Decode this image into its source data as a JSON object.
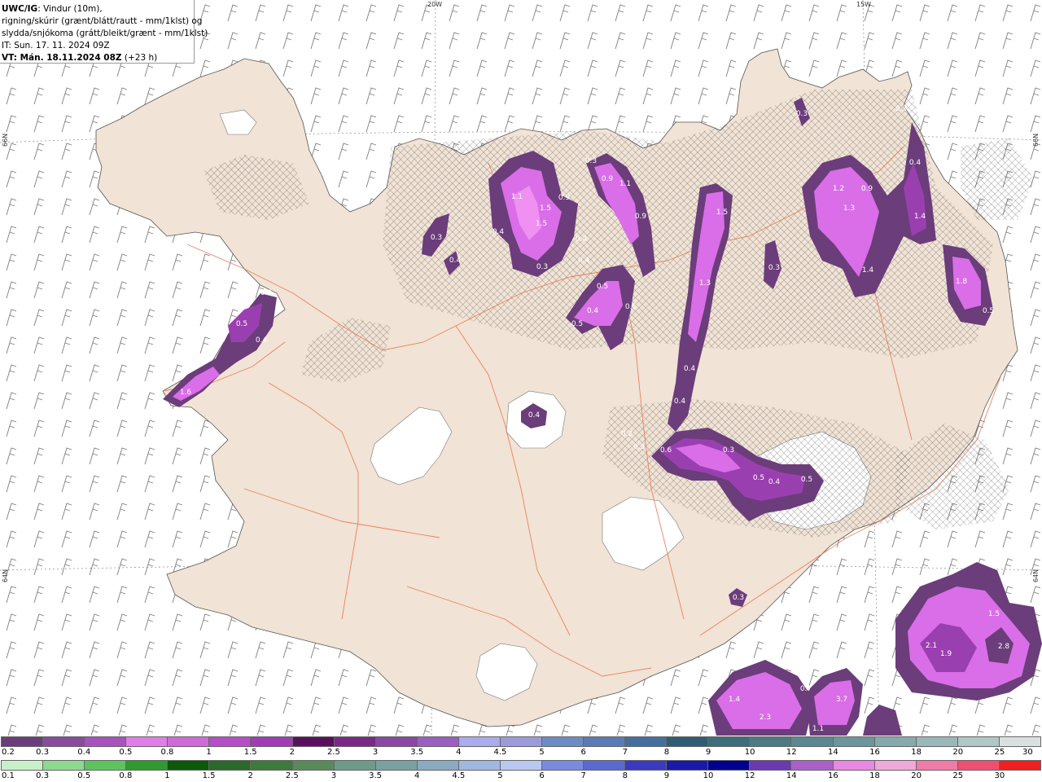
{
  "header": {
    "model": "UWC/IG",
    "desc1": ": Vindur (10m),",
    "desc2": "rigning/skúrir (grænt/blátt/rautt - mm/1klst) og",
    "desc3": "slydda/snjókoma (grátt/bleikt/grænt - mm/1klst)",
    "init": "IT: Sun. 17. 11. 2024 09Z",
    "valid_bold": "VT: Mán. 18.11.2024 08Z",
    "valid_rest": " (+23 h)"
  },
  "coords": {
    "top_20w": "20W",
    "top_15w": "15W",
    "left_66n": "66N",
    "right_66n": "66N",
    "left_64n": "64N",
    "right_64n": "64N"
  },
  "colors": {
    "land": "#f1e3d5",
    "ice": "#ffffff",
    "road": "#e8724a",
    "sleet_dark": "#6b3d7a",
    "sleet_mid": "#9a3fb0",
    "sleet_light": "#d96ee8",
    "sleet_pale": "#f090f0"
  },
  "values": [
    {
      "t": "0.4"
    },
    {
      "t": "0.5"
    },
    {
      "t": "0.4"
    },
    {
      "t": "1.6"
    },
    {
      "t": "0.3"
    },
    {
      "t": "0.4"
    },
    {
      "t": "1.1"
    },
    {
      "t": "1.5"
    },
    {
      "t": "1.5"
    },
    {
      "t": "0.4"
    },
    {
      "t": "0.3"
    },
    {
      "t": "0.9"
    },
    {
      "t": "0.3"
    },
    {
      "t": "0.9"
    },
    {
      "t": "1.1"
    },
    {
      "t": "0.4"
    },
    {
      "t": "0.4"
    },
    {
      "t": "0.9"
    },
    {
      "t": "0.5"
    },
    {
      "t": "0.4"
    },
    {
      "t": "0.6"
    },
    {
      "t": "0.5"
    },
    {
      "t": "1.5"
    },
    {
      "t": "1.3"
    },
    {
      "t": "0.4"
    },
    {
      "t": "0.4"
    },
    {
      "t": "0.3"
    },
    {
      "t": "0.3"
    },
    {
      "t": "1.2"
    },
    {
      "t": "0.9"
    },
    {
      "t": "1.3"
    },
    {
      "t": "1.4"
    },
    {
      "t": "0.4"
    },
    {
      "t": "1.4"
    },
    {
      "t": "1.8"
    },
    {
      "t": "0.5"
    },
    {
      "t": "0.3"
    },
    {
      "t": "0.4"
    },
    {
      "t": "0.2"
    },
    {
      "t": "0.3"
    },
    {
      "t": "0.6"
    },
    {
      "t": "0.3"
    },
    {
      "t": "0.5"
    },
    {
      "t": "0.4"
    },
    {
      "t": "0.5"
    },
    {
      "t": "0.3"
    },
    {
      "t": "1.5"
    },
    {
      "t": "2.1"
    },
    {
      "t": "1.9"
    },
    {
      "t": "2.8"
    },
    {
      "t": "1.4"
    },
    {
      "t": "2.3"
    },
    {
      "t": "0.7"
    },
    {
      "t": "3.7"
    },
    {
      "t": "1.1"
    }
  ],
  "legend": {
    "snow_labels": [
      "0.2",
      "0.3",
      "0.4",
      "0.5",
      "0.8",
      "1",
      "1.5",
      "2",
      "2.5",
      "3",
      "3.5",
      "4",
      "4.5",
      "5",
      "6",
      "7",
      "8",
      "9",
      "10",
      "12",
      "14",
      "16",
      "18",
      "20",
      "25",
      "30"
    ],
    "rain_labels": [
      "0.1",
      "0.3",
      "0.5",
      "0.8",
      "1",
      "1.5",
      "2",
      "2.5",
      "3",
      "3.5",
      "4",
      "4.5",
      "5",
      "6",
      "7",
      "8",
      "9",
      "10",
      "12",
      "14",
      "16",
      "18",
      "20",
      "25",
      "30"
    ],
    "snow_colors": [
      "#6b3d7a",
      "#8a4a9e",
      "#a852c0",
      "#e07ee8",
      "#d06ad8",
      "#b64ec8",
      "#a23bb4",
      "#5a1060",
      "#7a2a86",
      "#8b47a3",
      "#9a5fc0",
      "#aaaaee",
      "#9b9bdc",
      "#6f8bc6",
      "#5a7bb6",
      "#456ea0",
      "#2f5d73",
      "#3f6e7b",
      "#4d7a84",
      "#5b8891",
      "#6c969d",
      "#86a9ad",
      "#9ab7b9",
      "#b1c6c6",
      "#d9e1e0"
    ],
    "rain_colors": [
      "#c7f0c7",
      "#8fd88f",
      "#5dc45d",
      "#2f9a2f",
      "#0a5a0a",
      "#2a6a2a",
      "#3d7a3d",
      "#5a8a5a",
      "#6f9a8a",
      "#7aa0a0",
      "#8aaac0",
      "#a0b8e0",
      "#b8c8f0",
      "#7a8ae0",
      "#5a6ad0",
      "#3a3ac0",
      "#1a1aa8",
      "#000090",
      "#6a3ab0",
      "#aa60c8",
      "#e888e0",
      "#f0a8d8",
      "#f07aa8",
      "#f05070",
      "#f02020"
    ]
  }
}
